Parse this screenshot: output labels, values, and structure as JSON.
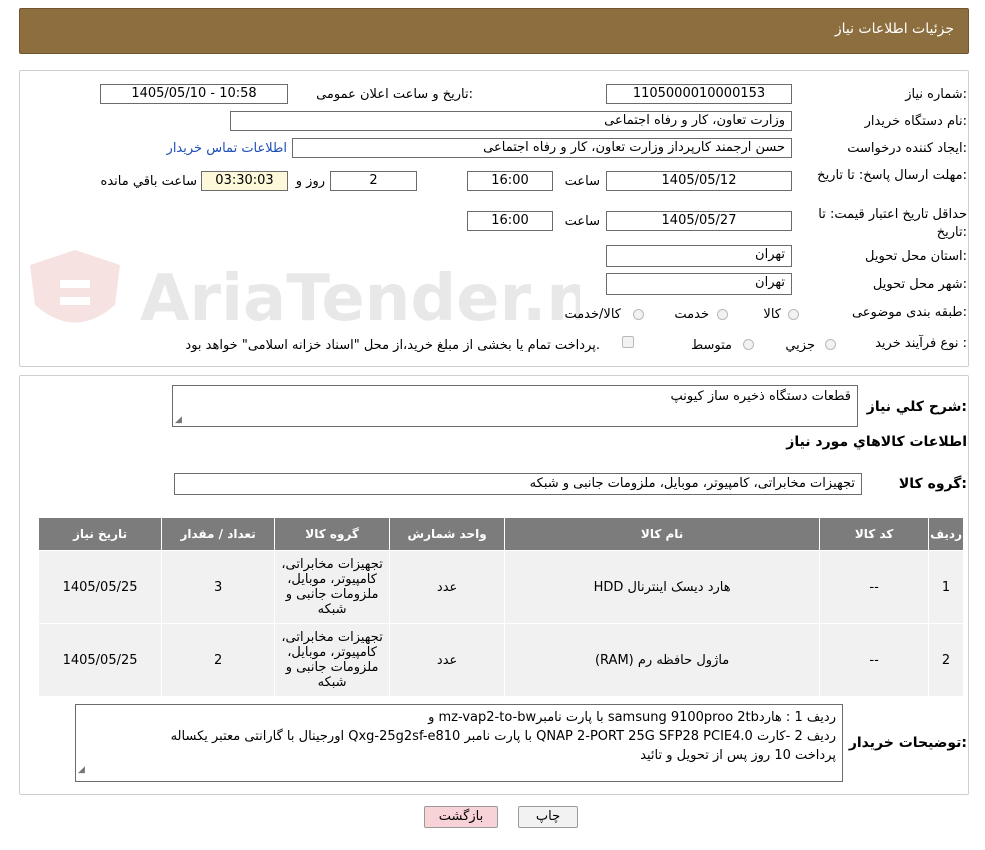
{
  "header": {
    "title": "جزئیات اطلاعات نیاز"
  },
  "form": {
    "need_number_label": "شماره نیاز:",
    "need_number": "1105000010000153",
    "announce_label": "تاریخ و ساعت اعلان عمومی:",
    "announce_value": "1405/05/10 - 10:58",
    "buyer_org_label": "نام دستگاه خریدار:",
    "buyer_org": "وزارت تعاون، کار و رفاه اجتماعی",
    "requester_label": "ایجاد کننده درخواست:",
    "requester": "حسن ارجمند کارپرداز وزارت تعاون، کار و رفاه اجتماعی",
    "contact_link": "اطلاعات تماس خریدار",
    "reply_deadline_label": "مهلت ارسال پاسخ: تا تاریخ:",
    "reply_date": "1405/05/12",
    "time_label": "ساعت",
    "reply_time": "16:00",
    "days_value": "2",
    "days_label": "روز و",
    "remaining_time": "03:30:03",
    "remaining_label": "ساعت باقي مانده",
    "price_validity_label": "حداقل تاریخ اعتبار قیمت: تا تاریخ:",
    "price_date": "1405/05/27",
    "price_time": "16:00",
    "province_label": "استان محل تحویل:",
    "province": "تهران",
    "city_label": "شهر محل تحویل:",
    "city": "تهران",
    "category_label": "طبقه بندی موضوعی:",
    "category_options": [
      "کالا",
      "خدمت",
      "کالا/خدمت"
    ],
    "process_label": "نوع فرآیند خرید :",
    "process_options": [
      "جزیي",
      "متوسط"
    ],
    "payment_note": "پرداخت تمام یا بخشی از مبلغ خرید،از محل \"اسناد خزانه اسلامی\" خواهد بود."
  },
  "details": {
    "summary_label": "شرح کلي نياز:",
    "summary": "قطعات دستگاه ذخیره ساز کیونپ",
    "goods_info_title": "اطلاعات کالاهاي مورد نياز",
    "goods_group_label": "گروه کالا:",
    "goods_group": "تجهیزات مخابراتی، کامپیوتر، موبایل، ملزومات جانبی و شبکه",
    "table": {
      "headers": [
        "رديف",
        "کد کالا",
        "نام کالا",
        "واحد شمارش",
        "گروه کالا",
        "تعداد / مقدار",
        "تاریخ نیاز"
      ],
      "rows": [
        [
          "1",
          "--",
          "هارد دیسک اینترنال HDD",
          "عدد",
          "تجهیزات مخابراتی، کامپیوتر، موبایل، ملزومات جانبی و شبکه",
          "3",
          "1405/05/25"
        ],
        [
          "2",
          "--",
          "ماژول حافظه رم (RAM)",
          "عدد",
          "تجهیزات مخابراتی، کامپیوتر، موبایل، ملزومات جانبی و شبکه",
          "2",
          "1405/05/25"
        ]
      ]
    },
    "buyer_notes_label": "توضیحات خریدار:",
    "buyer_notes": [
      "ردیف 1 : هاردsamsung 9100proo 2tb با پارت نامبرmz-vap2-to-bw   و",
      "ردیف 2 -کارت QNAP 2-PORT 25G SFP28 PCIE4.0 با پارت نامبر Qxg-25g2sf-e810  اورجینال با گارانتی معتبر یکساله",
      "پرداخت 10 روز پس از تحویل و تائید"
    ]
  },
  "buttons": {
    "print": "چاپ",
    "back": "بازگشت"
  },
  "watermark_text": "AriaTender.neT",
  "colors": {
    "header": "#8d6e3f",
    "table_header": "#7c7c7c",
    "back_button": "#f7d2d6",
    "link": "#1d4fb5"
  }
}
